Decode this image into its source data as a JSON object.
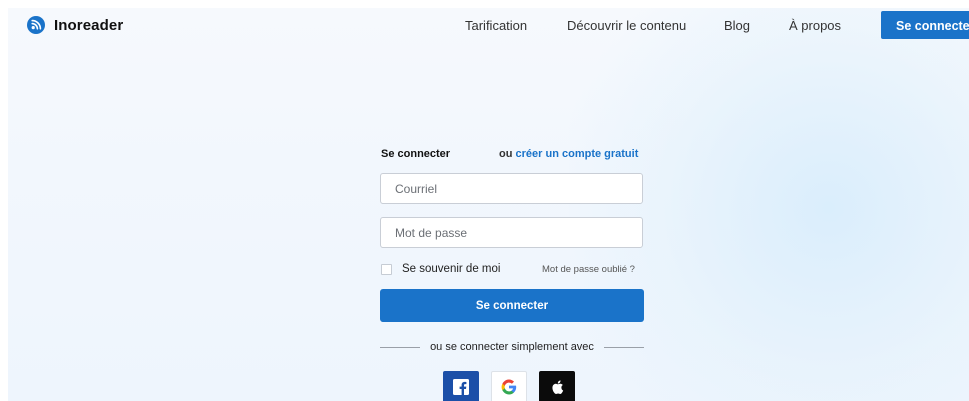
{
  "header": {
    "brand": "Inoreader",
    "nav": [
      {
        "label": "Tarification"
      },
      {
        "label": "Découvrir le contenu"
      },
      {
        "label": "Blog"
      },
      {
        "label": "À propos"
      }
    ],
    "login_button": "Se connecter"
  },
  "login": {
    "title": "Se connecter",
    "alt_prefix": "ou",
    "alt_link": "créer un compte gratuit",
    "email_placeholder": "Courriel",
    "password_placeholder": "Mot de passe",
    "remember_label": "Se souvenir de moi",
    "forgot_label": "Mot de passe oublié ?",
    "submit_label": "Se connecter",
    "social_label": "ou se connecter simplement avec",
    "social": [
      {
        "name": "facebook",
        "icon": "facebook-icon"
      },
      {
        "name": "google",
        "icon": "google-icon"
      },
      {
        "name": "apple",
        "icon": "apple-icon"
      }
    ]
  },
  "colors": {
    "accent": "#1a73c9",
    "facebook": "#1b4fa8",
    "apple": "#0b0b0b"
  }
}
